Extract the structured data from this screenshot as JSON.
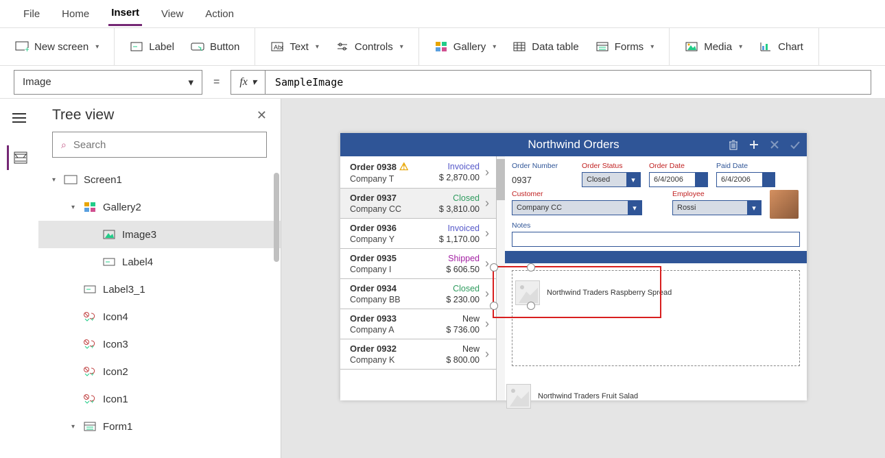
{
  "menu": {
    "items": [
      "File",
      "Home",
      "Insert",
      "View",
      "Action"
    ],
    "active": "Insert"
  },
  "ribbon": {
    "new_screen": "New screen",
    "label": "Label",
    "button": "Button",
    "text": "Text",
    "controls": "Controls",
    "gallery": "Gallery",
    "data_table": "Data table",
    "forms": "Forms",
    "media": "Media",
    "chart": "Chart"
  },
  "formula": {
    "property": "Image",
    "value": "SampleImage"
  },
  "tree": {
    "title": "Tree view",
    "search_placeholder": "Search",
    "items": [
      {
        "label": "Screen1",
        "depth": 0,
        "icon": "screen",
        "expand": "open"
      },
      {
        "label": "Gallery2",
        "depth": 1,
        "icon": "gallery",
        "expand": "open"
      },
      {
        "label": "Image3",
        "depth": 2,
        "icon": "image",
        "selected": true
      },
      {
        "label": "Label4",
        "depth": 2,
        "icon": "label"
      },
      {
        "label": "Label3_1",
        "depth": 1,
        "icon": "label"
      },
      {
        "label": "Icon4",
        "depth": 1,
        "icon": "icons"
      },
      {
        "label": "Icon3",
        "depth": 1,
        "icon": "icons"
      },
      {
        "label": "Icon2",
        "depth": 1,
        "icon": "icons"
      },
      {
        "label": "Icon1",
        "depth": 1,
        "icon": "icons"
      },
      {
        "label": "Form1",
        "depth": 1,
        "icon": "form",
        "expand": "open"
      }
    ]
  },
  "app": {
    "title": "Northwind Orders",
    "orders": [
      {
        "num": "Order 0938",
        "company": "Company T",
        "status": "Invoiced",
        "amount": "$ 2,870.00",
        "warn": true
      },
      {
        "num": "Order 0937",
        "company": "Company CC",
        "status": "Closed",
        "amount": "$ 3,810.00"
      },
      {
        "num": "Order 0936",
        "company": "Company Y",
        "status": "Invoiced",
        "amount": "$ 1,170.00"
      },
      {
        "num": "Order 0935",
        "company": "Company I",
        "status": "Shipped",
        "amount": "$ 606.50"
      },
      {
        "num": "Order 0934",
        "company": "Company BB",
        "status": "Closed",
        "amount": "$ 230.00"
      },
      {
        "num": "Order 0933",
        "company": "Company A",
        "status": "New",
        "amount": "$ 736.00"
      },
      {
        "num": "Order 0932",
        "company": "Company K",
        "status": "New",
        "amount": "$ 800.00"
      }
    ],
    "detail": {
      "order_number_label": "Order Number",
      "order_number": "0937",
      "order_status_label": "Order Status",
      "order_status": "Closed",
      "order_date_label": "Order Date",
      "order_date": "6/4/2006",
      "paid_date_label": "Paid Date",
      "paid_date": "6/4/2006",
      "customer_label": "Customer",
      "customer": "Company CC",
      "employee_label": "Employee",
      "employee": "Rossi",
      "notes_label": "Notes"
    },
    "orderlines": [
      "Northwind Traders Raspberry Spread",
      "Northwind Traders Fruit Salad"
    ]
  }
}
